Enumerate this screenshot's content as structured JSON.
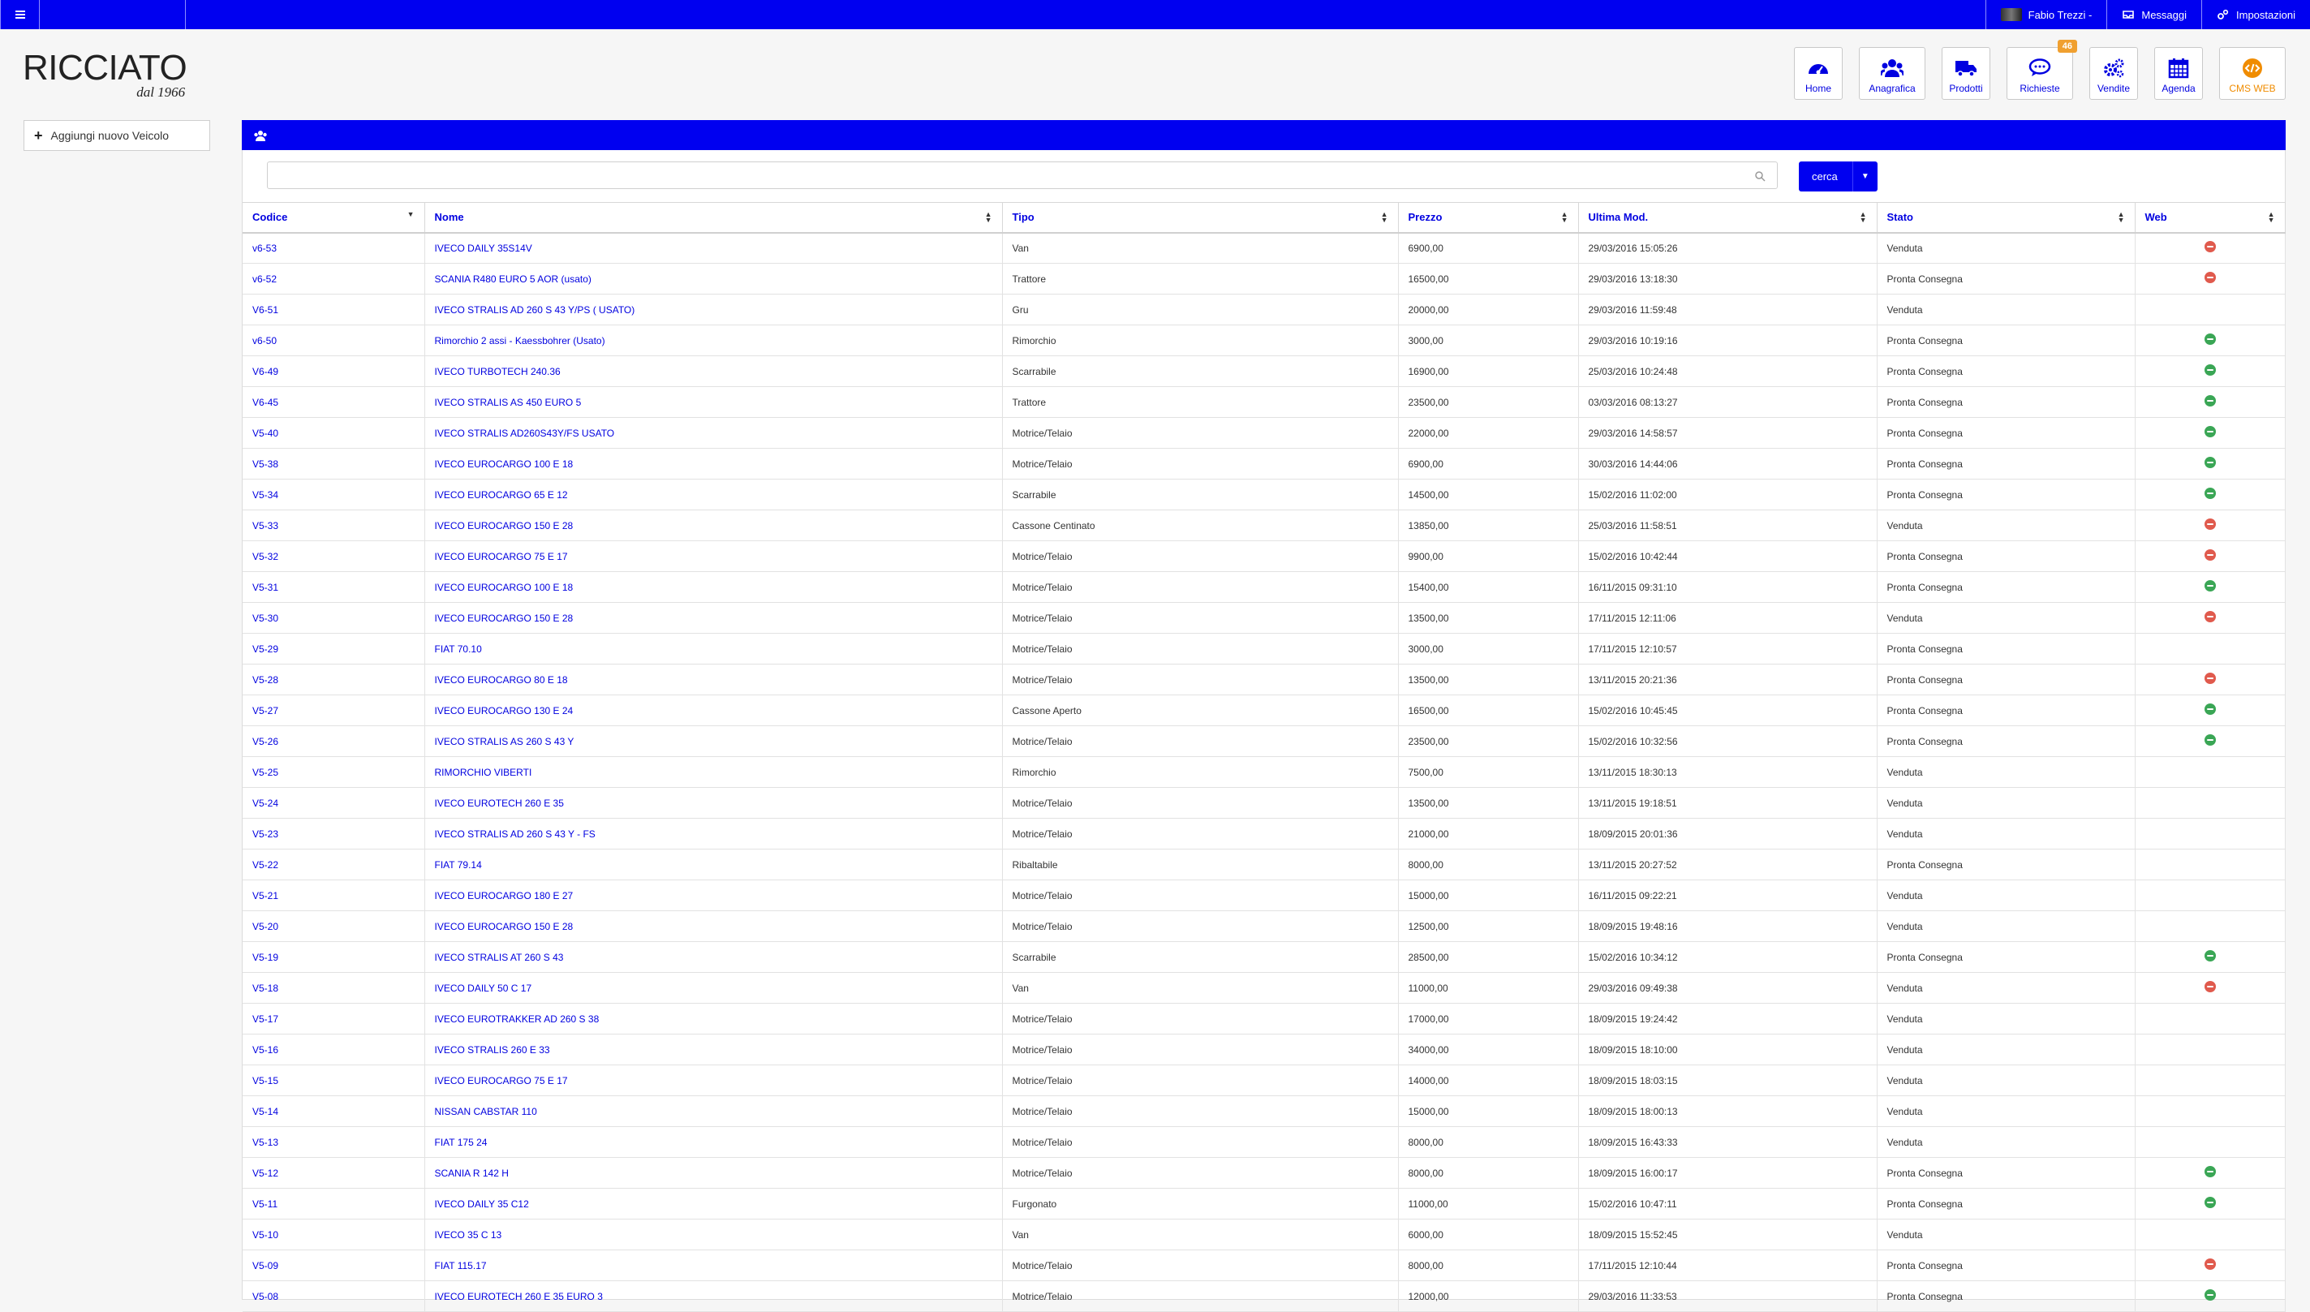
{
  "topbar": {
    "user": "Fabio Trezzi -",
    "messages": "Messaggi",
    "settings": "Impostazioni"
  },
  "brand": {
    "name": "RICCIATO",
    "tagline": "dal 1966"
  },
  "nav": [
    {
      "label": "Home",
      "icon": "dashboard-icon"
    },
    {
      "label": "Anagrafica",
      "icon": "users-icon"
    },
    {
      "label": "Prodotti",
      "icon": "truck-icon"
    },
    {
      "label": "Richieste",
      "icon": "chat-icon",
      "badge": "46"
    },
    {
      "label": "Vendite",
      "icon": "gears-icon"
    },
    {
      "label": "Agenda",
      "icon": "calendar-icon"
    },
    {
      "label": "CMS WEB",
      "icon": "cms-icon"
    }
  ],
  "sidebar": {
    "add_vehicle": "Aggiungi nuovo Veicolo"
  },
  "search": {
    "placeholder": "",
    "button": "cerca"
  },
  "colors": {
    "primary": "#0000f0",
    "accent": "#f08c00",
    "web_on": "#3aa655",
    "web_off": "#e05a4d"
  },
  "table": {
    "columns": [
      "Codice",
      "Nome",
      "Tipo",
      "Prezzo",
      "Ultima Mod.",
      "Stato",
      "Web"
    ],
    "rows": [
      [
        "v6-53",
        "IVECO DAILY 35S14V",
        "Van",
        "6900,00",
        "29/03/2016 15:05:26",
        "Venduta",
        "red"
      ],
      [
        "v6-52",
        "SCANIA R480 EURO 5 AOR (usato)",
        "Trattore",
        "16500,00",
        "29/03/2016 13:18:30",
        "Pronta Consegna",
        "red"
      ],
      [
        "V6-51",
        "IVECO STRALIS AD 260 S 43 Y/PS ( USATO)",
        "Gru",
        "20000,00",
        "29/03/2016 11:59:48",
        "Venduta",
        ""
      ],
      [
        "v6-50",
        "Rimorchio 2 assi - Kaessbohrer (Usato)",
        "Rimorchio",
        "3000,00",
        "29/03/2016 10:19:16",
        "Pronta Consegna",
        "green"
      ],
      [
        "V6-49",
        "IVECO TURBOTECH 240.36",
        "Scarrabile",
        "16900,00",
        "25/03/2016 10:24:48",
        "Pronta Consegna",
        "green"
      ],
      [
        "V6-45",
        "IVECO STRALIS AS 450 EURO 5",
        "Trattore",
        "23500,00",
        "03/03/2016 08:13:27",
        "Pronta Consegna",
        "green"
      ],
      [
        "V5-40",
        "IVECO STRALIS AD260S43Y/FS USATO",
        "Motrice/Telaio",
        "22000,00",
        "29/03/2016 14:58:57",
        "Pronta Consegna",
        "green"
      ],
      [
        "V5-38",
        "IVECO EUROCARGO 100 E 18",
        "Motrice/Telaio",
        "6900,00",
        "30/03/2016 14:44:06",
        "Pronta Consegna",
        "green"
      ],
      [
        "V5-34",
        "IVECO EUROCARGO 65 E 12",
        "Scarrabile",
        "14500,00",
        "15/02/2016 11:02:00",
        "Pronta Consegna",
        "green"
      ],
      [
        "V5-33",
        "IVECO EUROCARGO 150 E 28",
        "Cassone Centinato",
        "13850,00",
        "25/03/2016 11:58:51",
        "Venduta",
        "red"
      ],
      [
        "V5-32",
        "IVECO EUROCARGO 75 E 17",
        "Motrice/Telaio",
        "9900,00",
        "15/02/2016 10:42:44",
        "Pronta Consegna",
        "red"
      ],
      [
        "V5-31",
        "IVECO EUROCARGO 100 E 18",
        "Motrice/Telaio",
        "15400,00",
        "16/11/2015 09:31:10",
        "Pronta Consegna",
        "green"
      ],
      [
        "V5-30",
        "IVECO EUROCARGO 150 E 28",
        "Motrice/Telaio",
        "13500,00",
        "17/11/2015 12:11:06",
        "Venduta",
        "red"
      ],
      [
        "V5-29",
        "FIAT 70.10",
        "Motrice/Telaio",
        "3000,00",
        "17/11/2015 12:10:57",
        "Pronta Consegna",
        ""
      ],
      [
        "V5-28",
        "IVECO EUROCARGO 80 E 18",
        "Motrice/Telaio",
        "13500,00",
        "13/11/2015 20:21:36",
        "Pronta Consegna",
        "red"
      ],
      [
        "V5-27",
        "IVECO EUROCARGO 130 E 24",
        "Cassone Aperto",
        "16500,00",
        "15/02/2016 10:45:45",
        "Pronta Consegna",
        "green"
      ],
      [
        "V5-26",
        "IVECO STRALIS AS 260 S 43 Y",
        "Motrice/Telaio",
        "23500,00",
        "15/02/2016 10:32:56",
        "Pronta Consegna",
        "green"
      ],
      [
        "V5-25",
        "RIMORCHIO VIBERTI",
        "Rimorchio",
        "7500,00",
        "13/11/2015 18:30:13",
        "Venduta",
        ""
      ],
      [
        "V5-24",
        "IVECO EUROTECH 260 E 35",
        "Motrice/Telaio",
        "13500,00",
        "13/11/2015 19:18:51",
        "Venduta",
        ""
      ],
      [
        "V5-23",
        "IVECO STRALIS AD 260 S 43 Y - FS",
        "Motrice/Telaio",
        "21000,00",
        "18/09/2015 20:01:36",
        "Venduta",
        ""
      ],
      [
        "V5-22",
        "FIAT 79.14",
        "Ribaltabile",
        "8000,00",
        "13/11/2015 20:27:52",
        "Pronta Consegna",
        ""
      ],
      [
        "V5-21",
        "IVECO EUROCARGO 180 E 27",
        "Motrice/Telaio",
        "15000,00",
        "16/11/2015 09:22:21",
        "Venduta",
        ""
      ],
      [
        "V5-20",
        "IVECO EUROCARGO 150 E 28",
        "Motrice/Telaio",
        "12500,00",
        "18/09/2015 19:48:16",
        "Venduta",
        ""
      ],
      [
        "V5-19",
        "IVECO STRALIS AT 260 S 43",
        "Scarrabile",
        "28500,00",
        "15/02/2016 10:34:12",
        "Pronta Consegna",
        "green"
      ],
      [
        "V5-18",
        "IVECO DAILY 50 C 17",
        "Van",
        "11000,00",
        "29/03/2016 09:49:38",
        "Venduta",
        "red"
      ],
      [
        "V5-17",
        "IVECO EUROTRAKKER AD 260 S 38",
        "Motrice/Telaio",
        "17000,00",
        "18/09/2015 19:24:42",
        "Venduta",
        ""
      ],
      [
        "V5-16",
        "IVECO STRALIS 260 E 33",
        "Motrice/Telaio",
        "34000,00",
        "18/09/2015 18:10:00",
        "Venduta",
        ""
      ],
      [
        "V5-15",
        "IVECO EUROCARGO 75 E 17",
        "Motrice/Telaio",
        "14000,00",
        "18/09/2015 18:03:15",
        "Venduta",
        ""
      ],
      [
        "V5-14",
        "NISSAN CABSTAR 110",
        "Motrice/Telaio",
        "15000,00",
        "18/09/2015 18:00:13",
        "Venduta",
        ""
      ],
      [
        "V5-13",
        "FIAT 175 24",
        "Motrice/Telaio",
        "8000,00",
        "18/09/2015 16:43:33",
        "Venduta",
        ""
      ],
      [
        "V5-12",
        "SCANIA R 142 H",
        "Motrice/Telaio",
        "8000,00",
        "18/09/2015 16:00:17",
        "Pronta Consegna",
        "green"
      ],
      [
        "V5-11",
        "IVECO DAILY 35 C12",
        "Furgonato",
        "11000,00",
        "15/02/2016 10:47:11",
        "Pronta Consegna",
        "green"
      ],
      [
        "V5-10",
        "IVECO 35 C 13",
        "Van",
        "6000,00",
        "18/09/2015 15:52:45",
        "Venduta",
        ""
      ],
      [
        "V5-09",
        "FIAT 115.17",
        "Motrice/Telaio",
        "8000,00",
        "17/11/2015 12:10:44",
        "Pronta Consegna",
        "red"
      ],
      [
        "V5-08",
        "IVECO EUROTECH 260 E 35 EURO 3",
        "Motrice/Telaio",
        "12000,00",
        "29/03/2016 11:33:53",
        "Pronta Consegna",
        "green"
      ]
    ]
  }
}
